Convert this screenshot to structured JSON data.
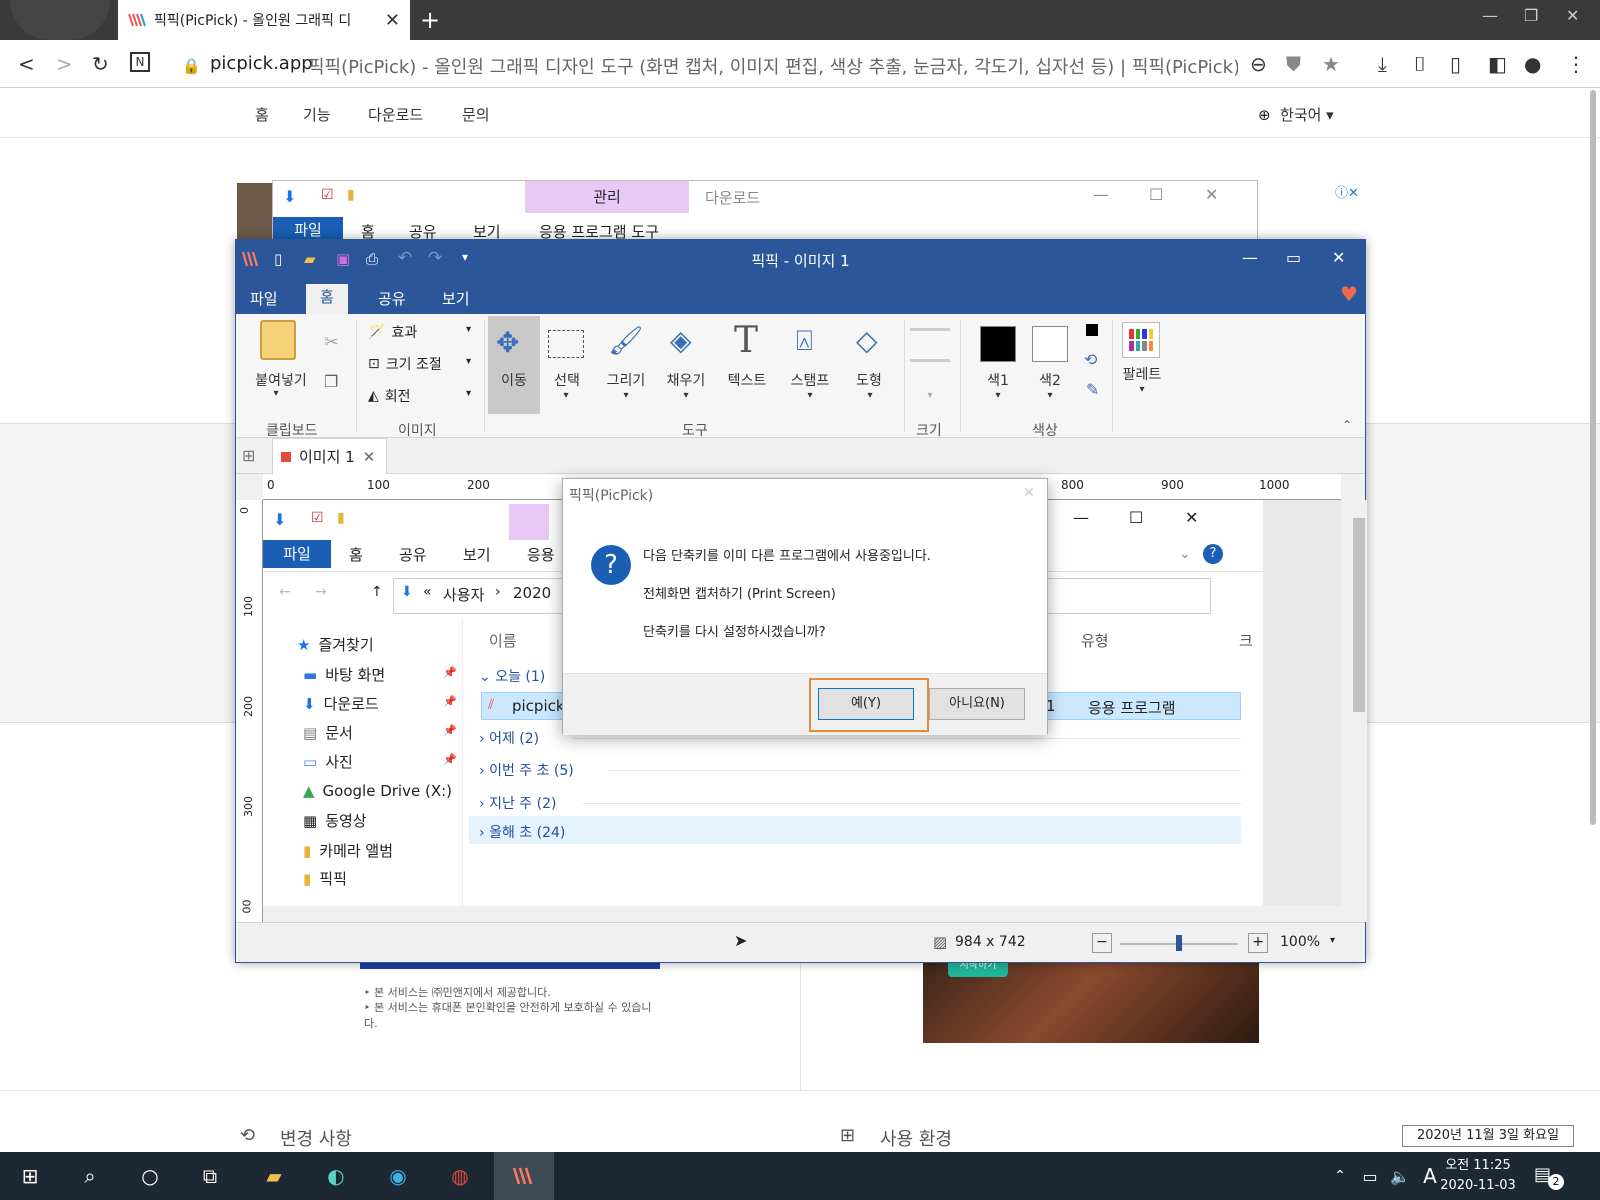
{
  "browser": {
    "tab_title": "픽픽(PicPick) - 올인원 그래픽 디",
    "url_host": "picpick.app",
    "page_title": "픽픽(PicPick) - 올인원 그래픽 디자인 도구 (화면 캡처, 이미지 편집, 색상 추출, 눈금자, 각도기, 십자선 등) | 픽픽(PicPick)"
  },
  "site": {
    "nav": [
      "홈",
      "기능",
      "다운로드",
      "문의"
    ],
    "language": "한국어",
    "notes": [
      "본 서비스는 ㈜민앤지에서 제공합니다.",
      "본 서비스는 휴대폰 본인확인을 안전하게 보호하실 수 있습니다."
    ],
    "ad_button": "시작하기",
    "sections": [
      "변경 사항",
      "사용 환경"
    ],
    "date_tooltip": "2020년 11월 3일 화요일"
  },
  "bg_explorer": {
    "manage_tab": "관리",
    "title": "다운로드",
    "menu": [
      "파일",
      "홈",
      "공유",
      "보기"
    ],
    "app_tools": "응용 프로그램 도구"
  },
  "picpick": {
    "title": "픽픽 - 이미지 1",
    "menu": [
      "파일",
      "홈",
      "공유",
      "보기"
    ],
    "ribbon": {
      "paste": "붙여넣기",
      "clipboard": "클립보드",
      "effect": "효과",
      "resize": "크기 조절",
      "rotate": "회전",
      "image": "이미지",
      "tools": [
        "이동",
        "선택",
        "그리기",
        "채우기",
        "텍스트",
        "스탬프",
        "도형"
      ],
      "tools_group": "도구",
      "size_group": "크기",
      "color1": "색1",
      "color2": "색2",
      "color_group": "색상",
      "palette": "팔레트"
    },
    "image_tab": "이미지 1",
    "ruler_labels": [
      "0",
      "100",
      "200",
      "800",
      "900",
      "1000"
    ],
    "vruler_labels": [
      "0",
      "100",
      "200",
      "300",
      "00"
    ],
    "status": {
      "dimensions": "984 x 742",
      "zoom": "100%",
      "zoom_level": 0.5
    }
  },
  "captured_explorer": {
    "menu": [
      "파일",
      "홈",
      "공유",
      "보기",
      "응용"
    ],
    "breadcrumb": [
      "사용자",
      "2020"
    ],
    "col_name": "이름",
    "col_type": "유형",
    "col_size": "크",
    "nav_items": [
      "즐겨찾기",
      "바탕 화면",
      "다운로드",
      "문서",
      "사진",
      "Google Drive (X:)",
      "동영상",
      "카메라 앨범",
      "픽픽"
    ],
    "groups": [
      "오늘 (1)",
      "어제 (2)",
      "이번 주 초 (5)",
      "지난 주 (2)",
      "올해 초 (24)"
    ],
    "file_name": "picpick",
    "file_count": "1",
    "file_type": "응용 프로그램"
  },
  "dialog": {
    "title": "픽픽(PicPick)",
    "line1": "다음 단축키를 이미 다른 프로그램에서 사용중입니다.",
    "line2": "전체화면 캡처하기 (Print Screen)",
    "line3": "단축키를 다시 설정하시겠습니까?",
    "yes": "예(Y)",
    "no": "아니요(N)"
  },
  "taskbar": {
    "time": "오전 11:25",
    "date": "2020-11-03",
    "ime": "A",
    "notif_count": "2"
  },
  "colors": {
    "picpick_blue": "#2b579a",
    "focus_orange": "#e38b3c",
    "taskbar": "#1c2833"
  }
}
